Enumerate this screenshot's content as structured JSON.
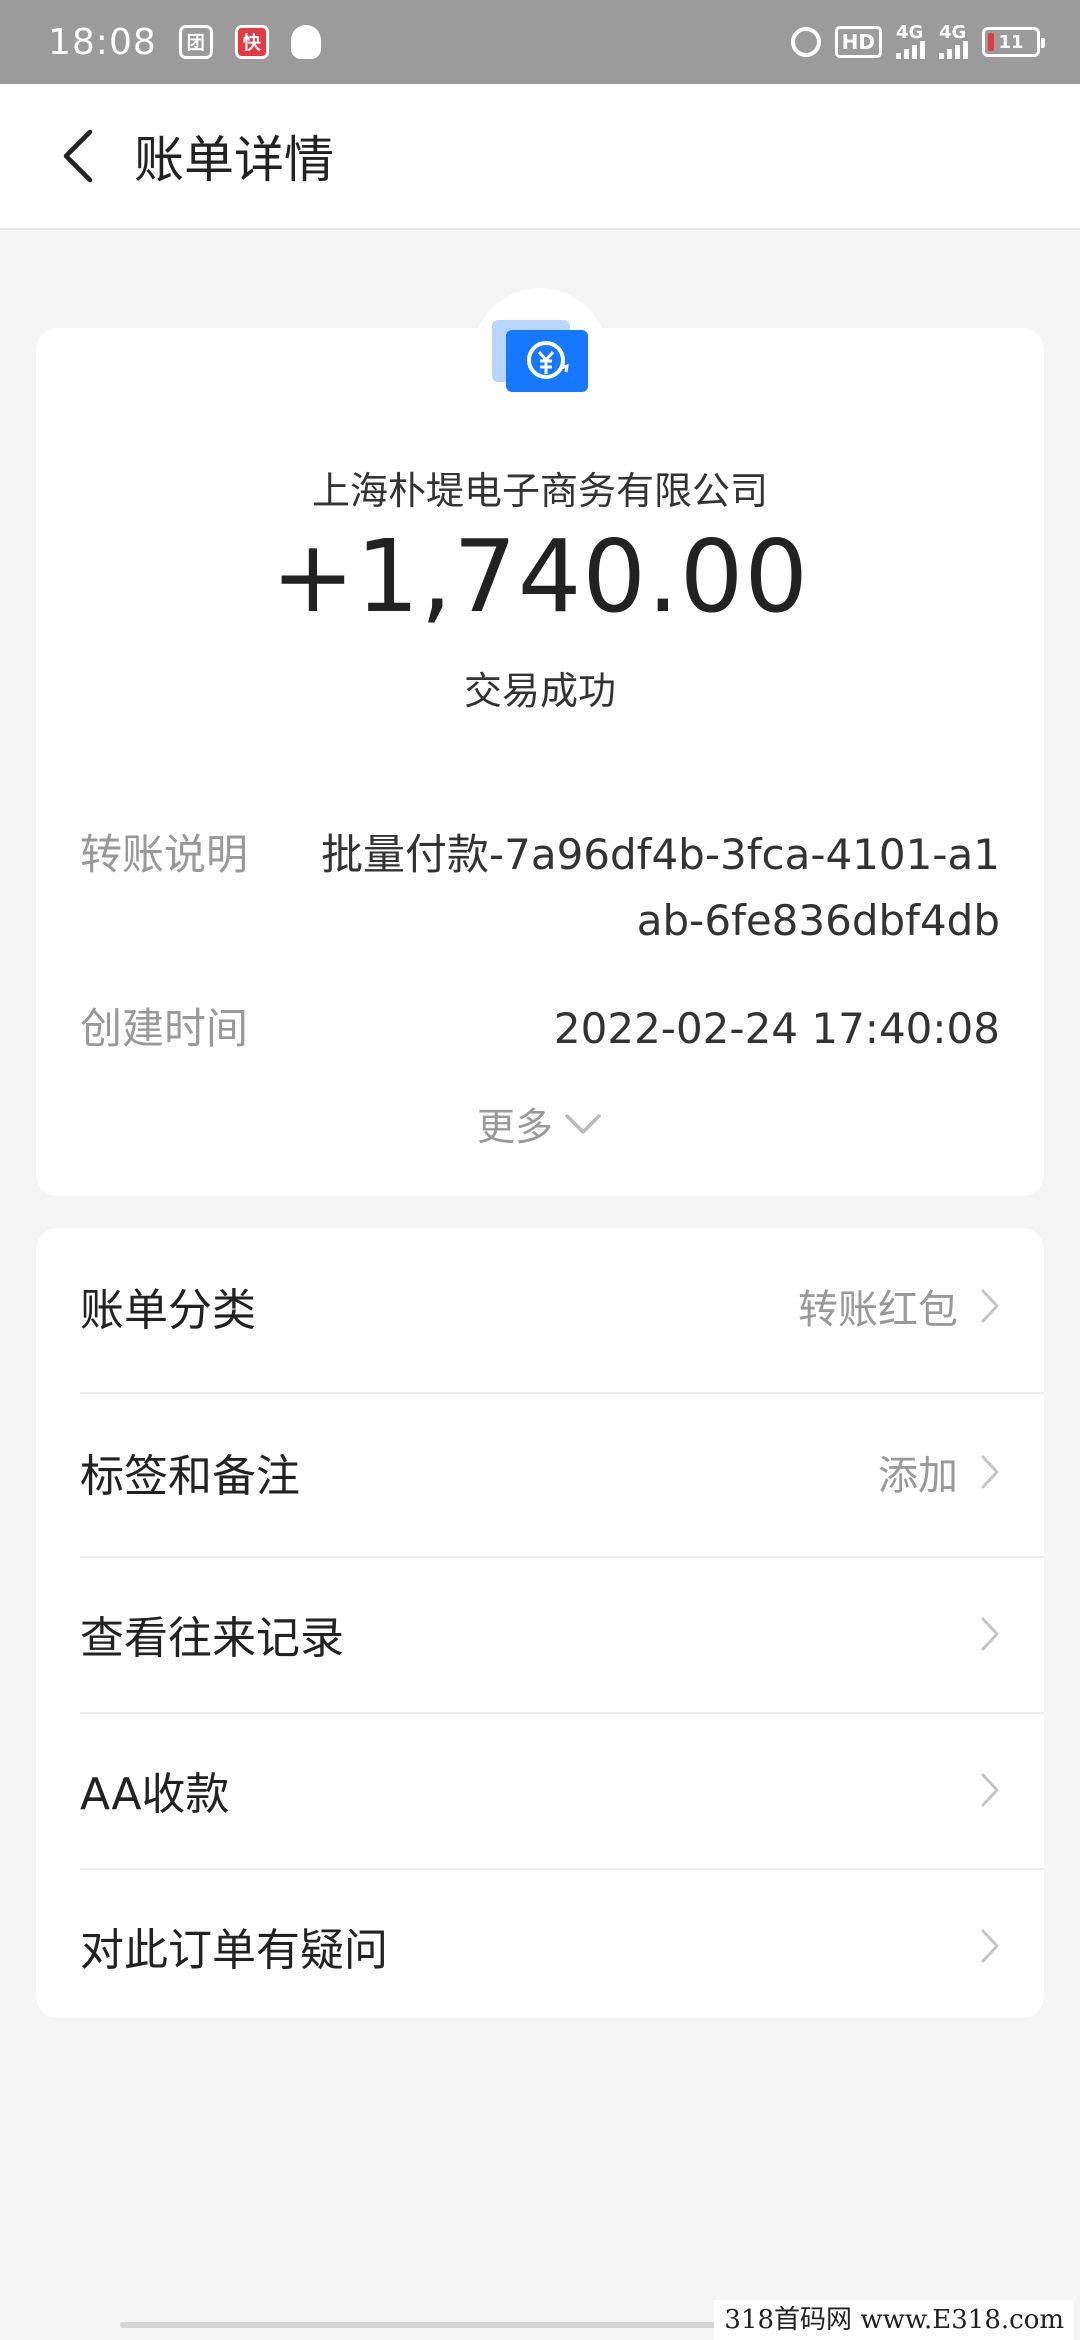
{
  "status_bar": {
    "time": "18:08",
    "app_icon_1": "团",
    "app_icon_2": "快",
    "hd_label": "HD",
    "sim1_network": "4G",
    "sim2_network": "4G",
    "battery_level": "11"
  },
  "header": {
    "title": "账单详情"
  },
  "summary": {
    "merchant": "上海朴堤电子商务有限公司",
    "amount": "+1,740.00",
    "status": "交易成功",
    "details": [
      {
        "label": "转账说明",
        "value": "批量付款-7a96df4b-3fca-4101-a1ab-6fe836dbf4db"
      },
      {
        "label": "创建时间",
        "value": "2022-02-24 17:40:08"
      }
    ],
    "more_label": "更多"
  },
  "list": {
    "items": [
      {
        "label": "账单分类",
        "value": "转账红包"
      },
      {
        "label": "标签和备注",
        "value": "添加"
      },
      {
        "label": "查看往来记录",
        "value": ""
      },
      {
        "label": "AA收款",
        "value": ""
      },
      {
        "label": "对此订单有疑问",
        "value": ""
      }
    ]
  },
  "watermark": "318首码网 www.E318.com",
  "colors": {
    "background": "#f5f5f5",
    "card": "#ffffff",
    "icon_blue": "#1677ff",
    "muted_text": "#999999"
  }
}
